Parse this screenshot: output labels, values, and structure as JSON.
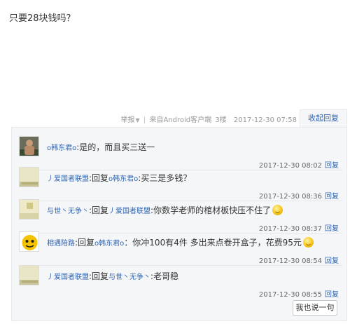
{
  "post": {
    "text": "只要28块钱吗？"
  },
  "meta": {
    "report": "举报",
    "source": "来自Android客户端",
    "floor": "3楼",
    "time": "2017-12-30 07:58",
    "collapse_label": "收起回复"
  },
  "replies": [
    {
      "user": "o韩东君o",
      "prefix": "",
      "target": "",
      "text": ":是的，而且买三送一",
      "time": "2017-12-30 08:02",
      "reply_label": "回复",
      "emoji": ""
    },
    {
      "user": "丿爱国者联盟",
      "prefix": ":回复",
      "target": "o韩东君o",
      "text": ":买三是多钱？",
      "time": "2017-12-30 08:36",
      "reply_label": "回复",
      "emoji": ""
    },
    {
      "user": "与世丶无争丶",
      "prefix": ":回复",
      "target": "丿爱国者联盟",
      "text": ":你数学老师的棺材板快压不住了",
      "time": "2017-12-30 08:37",
      "reply_label": "回复",
      "emoji": "smiley"
    },
    {
      "user": "相遇陪路",
      "prefix": ":回复",
      "target": "o韩东君o",
      "text": "：你冲100有4件 多出来点卷开盒子，花费95元",
      "time": "2017-12-30 08:54",
      "reply_label": "回复",
      "emoji": "smiley"
    },
    {
      "user": "丿爱国者联盟",
      "prefix": ":回复",
      "target": "与世丶无争丶",
      "text": ":老哥稳",
      "time": "2017-12-30 08:55",
      "reply_label": "回复",
      "emoji": ""
    }
  ],
  "speak_button": "我也说一句",
  "colors": {
    "link": "#2d64b3",
    "panel_bg": "#f5f6f8",
    "border": "#e8e9ec"
  }
}
